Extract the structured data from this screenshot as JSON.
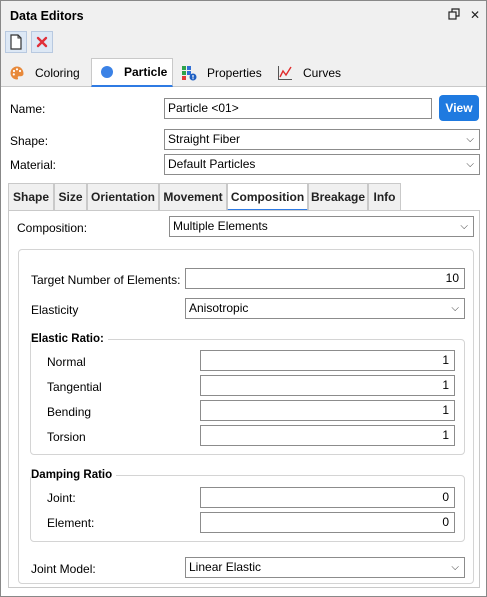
{
  "window": {
    "title": "Data Editors"
  },
  "main_tabs": [
    {
      "label": "Coloring",
      "icon": "palette-icon"
    },
    {
      "label": "Particle",
      "icon": "circle-icon"
    },
    {
      "label": "Properties",
      "icon": "properties-icon"
    },
    {
      "label": "Curves",
      "icon": "chart-icon"
    }
  ],
  "particle": {
    "name_label": "Name:",
    "name_value": "Particle <01>",
    "view_label": "View",
    "shape_label": "Shape:",
    "shape_value": "Straight Fiber",
    "material_label": "Material:",
    "material_value": "Default Particles"
  },
  "sub_tabs": [
    "Shape",
    "Size",
    "Orientation",
    "Movement",
    "Composition",
    "Breakage",
    "Info"
  ],
  "composition": {
    "label": "Composition:",
    "value": "Multiple Elements",
    "target_label": "Target Number of Elements:",
    "target_value": "10",
    "elasticity_label": "Elasticity",
    "elasticity_value": "Anisotropic",
    "elastic_ratio": {
      "title": "Elastic Ratio:",
      "rows": [
        {
          "label": "Normal",
          "value": "1"
        },
        {
          "label": "Tangential",
          "value": "1"
        },
        {
          "label": "Bending",
          "value": "1"
        },
        {
          "label": "Torsion",
          "value": "1"
        }
      ]
    },
    "damping_ratio": {
      "title": "Damping Ratio",
      "rows": [
        {
          "label": "Joint:",
          "value": "0"
        },
        {
          "label": "Element:",
          "value": "0"
        }
      ]
    },
    "joint_model_label": "Joint Model:",
    "joint_model_value": "Linear Elastic"
  },
  "colors": {
    "accent": "#1f7ae0",
    "close_red": "#e0303a"
  }
}
